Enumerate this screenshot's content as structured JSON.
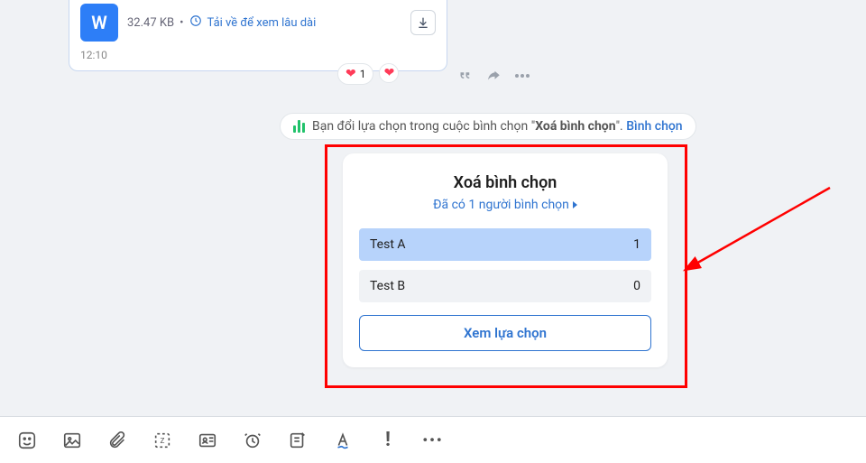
{
  "file": {
    "ext_letter": "W",
    "size": "32.47 KB",
    "dot": "•",
    "download_note": "Tải về để xem lâu dài",
    "time": "12:10"
  },
  "reactions": {
    "count": "1"
  },
  "notice": {
    "prefix": "Bạn đổi lựa chọn trong cuộc bình chọn \"",
    "poll_name": "Xoá bình chọn",
    "suffix": "\". ",
    "link": "Bình chọn"
  },
  "poll": {
    "title": "Xoá bình chọn",
    "subtitle": "Đã có 1 người bình chọn",
    "options": [
      {
        "label": "Test A",
        "count": "1"
      },
      {
        "label": "Test B",
        "count": "0"
      }
    ],
    "view_btn": "Xem lựa chọn"
  }
}
